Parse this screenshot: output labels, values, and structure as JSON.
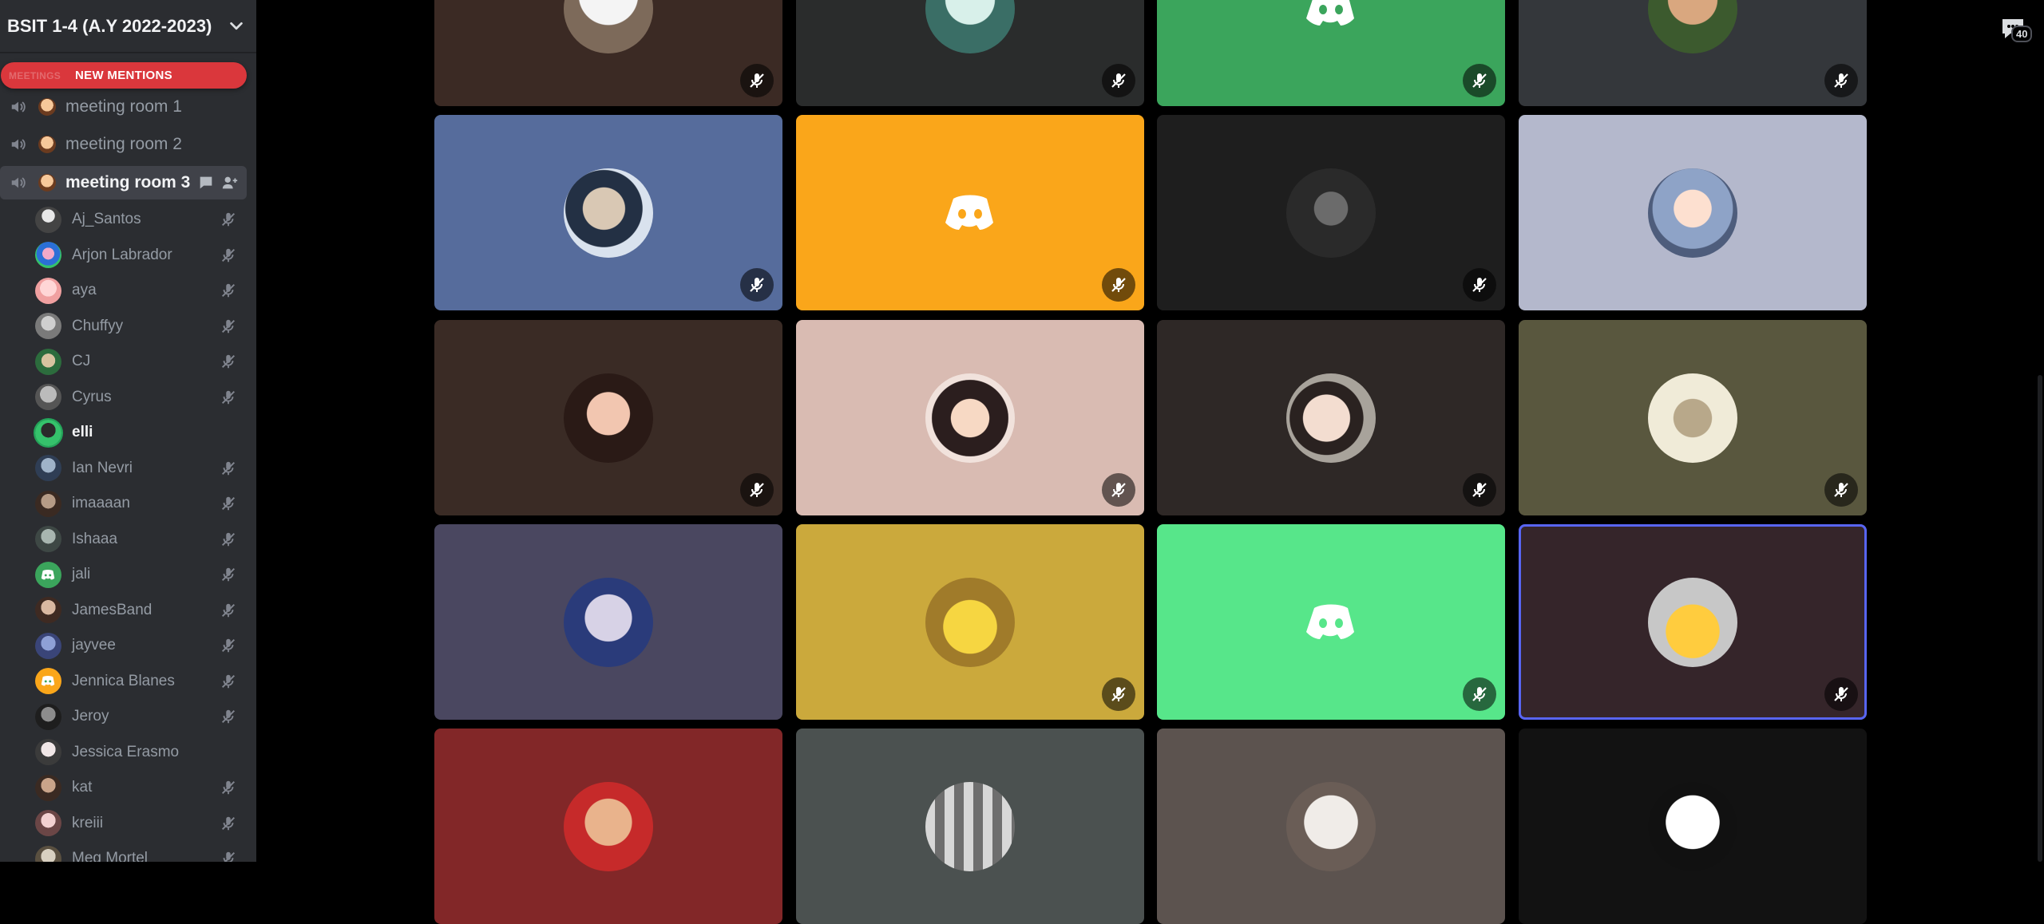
{
  "server": {
    "name": "BSIT 1-4 (A.Y 2022-2023)"
  },
  "mentions": {
    "label": "NEW MENTIONS",
    "ghost_label": "MEETINGS"
  },
  "channels": [
    {
      "label": "meeting room 1"
    },
    {
      "label": "meeting room 2"
    },
    {
      "label": "meeting room 3"
    }
  ],
  "members": [
    {
      "name": "Aj_Santos",
      "muted": true
    },
    {
      "name": "Arjon Labrador",
      "muted": true
    },
    {
      "name": "aya",
      "muted": true
    },
    {
      "name": "Chuffyy",
      "muted": true
    },
    {
      "name": "CJ",
      "muted": true
    },
    {
      "name": "Cyrus",
      "muted": true
    },
    {
      "name": "elli",
      "muted": false
    },
    {
      "name": "Ian Nevri",
      "muted": true
    },
    {
      "name": "imaaaan",
      "muted": true
    },
    {
      "name": "Ishaaa",
      "muted": true
    },
    {
      "name": "jali",
      "muted": true
    },
    {
      "name": "JamesBand",
      "muted": true
    },
    {
      "name": "jayvee",
      "muted": true
    },
    {
      "name": "Jennica Blanes",
      "muted": true
    },
    {
      "name": "Jeroy",
      "muted": true
    },
    {
      "name": "Jessica Erasmo",
      "muted": false
    },
    {
      "name": "kat",
      "muted": true
    },
    {
      "name": "kreiii",
      "muted": true
    },
    {
      "name": "Meg Mortel",
      "muted": true
    }
  ],
  "chat": {
    "unread_count": "40"
  },
  "colors": {
    "sidebar_bg": "#2b2d31",
    "active_channel": "#404249",
    "mentions_red": "#da373c",
    "selected_outline": "#5865f2",
    "muted_text": "#949ba4",
    "bright_text": "#f2f3f5"
  },
  "icons": {
    "speaker": "speaker-icon",
    "mute": "mic-muted-icon",
    "chat": "chat-bubble-icon",
    "add_user": "add-user-icon",
    "discord": "discord-logo-icon"
  },
  "tiles": [
    {
      "row": 0,
      "col": 0,
      "bg": "#3b2a24",
      "muted": true
    },
    {
      "row": 0,
      "col": 1,
      "bg": "#2a2c2c",
      "muted": true
    },
    {
      "row": 0,
      "col": 2,
      "bg": "#3ba55c",
      "muted": true
    },
    {
      "row": 0,
      "col": 3,
      "bg": "#34373b",
      "muted": true
    },
    {
      "row": 1,
      "col": 0,
      "bg": "#566c9c",
      "muted": true
    },
    {
      "row": 1,
      "col": 1,
      "bg": "#faa61a",
      "muted": true
    },
    {
      "row": 1,
      "col": 2,
      "bg": "#1e1e1e",
      "muted": true
    },
    {
      "row": 1,
      "col": 3,
      "bg": "#b4b8cc",
      "muted": false
    },
    {
      "row": 2,
      "col": 0,
      "bg": "#3a2b25",
      "muted": true
    },
    {
      "row": 2,
      "col": 1,
      "bg": "#d9bbb2",
      "muted": true
    },
    {
      "row": 2,
      "col": 2,
      "bg": "#2e2826",
      "muted": true
    },
    {
      "row": 2,
      "col": 3,
      "bg": "#59573e",
      "muted": true
    },
    {
      "row": 3,
      "col": 0,
      "bg": "#4a4760",
      "muted": false
    },
    {
      "row": 3,
      "col": 1,
      "bg": "#cba93c",
      "muted": true
    },
    {
      "row": 3,
      "col": 2,
      "bg": "#57e68a",
      "muted": true
    },
    {
      "row": 3,
      "col": 3,
      "bg": "#35252a",
      "muted": true,
      "selected": true
    },
    {
      "row": 4,
      "col": 0,
      "bg": "#822728",
      "muted": false
    },
    {
      "row": 4,
      "col": 1,
      "bg": "#4b5150",
      "muted": false
    },
    {
      "row": 4,
      "col": 2,
      "bg": "#5c534f",
      "muted": false
    },
    {
      "row": 4,
      "col": 3,
      "bg": "#121212",
      "muted": false
    }
  ]
}
